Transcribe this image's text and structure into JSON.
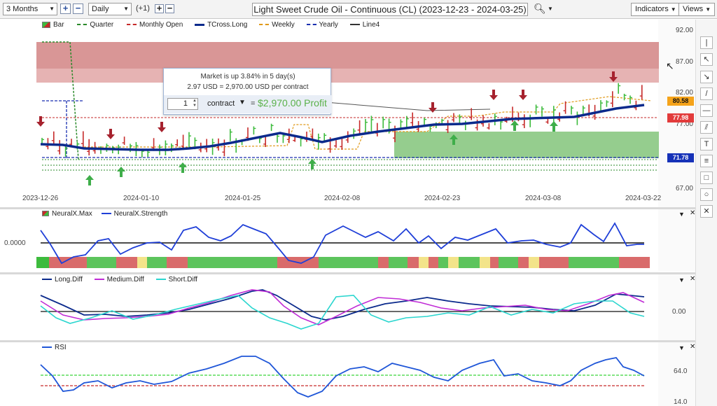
{
  "toolbar": {
    "range": "3 Months",
    "interval": "Daily",
    "counter": "(+1)",
    "title": "Light Sweet Crude Oil - Continuous (CL) (2023-12-23 - 2024-03-25)",
    "indicators": "Indicators",
    "views": "Views"
  },
  "main_legend": {
    "bar": "Bar",
    "quarter": "Quarter",
    "monthly_open": "Monthly Open",
    "tcross": "TCross.Long",
    "weekly": "Weekly",
    "yearly": "Yearly",
    "line4": "Line4"
  },
  "tooltip": {
    "line1": "Market is up 3.84% in 5 day(s)",
    "line2": "2.97 USD = 2,970.00 USD per contract",
    "qty": "1",
    "unit": "contract",
    "eq": "=",
    "profit": "$2,970.00 Profit"
  },
  "price_axis": [
    "92.00",
    "87.00",
    "82.00",
    "77.00",
    "72.00",
    "67.00"
  ],
  "price_boxes": {
    "current": "80.58",
    "monthly": "77.98",
    "yearly": "71.78"
  },
  "date_axis": [
    "2023-12-26",
    "2024-01-10",
    "2024-01-25",
    "2024-02-08",
    "2024-02-23",
    "2024-03-08",
    "2024-03-22"
  ],
  "neural_legend": {
    "max": "NeuralX.Max",
    "strength": "NeuralX.Strength",
    "axis": "0.0000"
  },
  "diff_legend": {
    "long": "Long.Diff",
    "medium": "Medium.Diff",
    "short": "Short.Diff",
    "axis": "0.00"
  },
  "rsi_legend": {
    "rsi": "RSI",
    "upper": "64.0",
    "lower": "14.0"
  },
  "colors": {
    "up": "#3dbb3d",
    "down": "#c62a2a",
    "tcross": "#0b2a8c",
    "long": "#0b2a8c",
    "medium": "#c02bd6",
    "short": "#2bd6cf",
    "rsi": "#1f56d8"
  },
  "chart_data": [
    {
      "type": "line",
      "title": "Light Sweet Crude Oil - Continuous (CL)",
      "x": [
        "2023-12-26",
        "2024-01-10",
        "2024-01-25",
        "2024-02-08",
        "2024-02-23",
        "2024-03-08",
        "2024-03-22"
      ],
      "series": [
        {
          "name": "TCross.Long",
          "values": [
            72.6,
            72.2,
            72.4,
            73.2,
            74.1,
            76.9,
            78.9,
            80.4
          ]
        },
        {
          "name": "Bar",
          "values": [
            73.5,
            71.1,
            71.2,
            75.9,
            74.8,
            76.3,
            78.4,
            79.6,
            81.5,
            80.3
          ]
        }
      ],
      "ylim": [
        67,
        92
      ],
      "levels": {
        "monthly_open": 77.98,
        "yearly": 71.78,
        "current": 80.58
      }
    }
  ]
}
